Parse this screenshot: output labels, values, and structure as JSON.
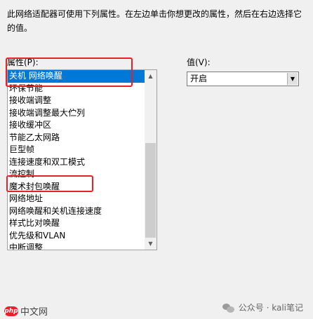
{
  "description": "此网络适配器可使用下列属性。在左边单击你想更改的属性，然后在右边选择它的值。",
  "property_label": "属性(P):",
  "value_label": "值(V):",
  "properties": [
    "关机 网络唤醒",
    "环保节能",
    "接收端调整",
    "接收端调整最大伫列",
    "接收缓冲区",
    "节能乙太网路",
    "巨型帧",
    "连接速度和双工模式",
    "流控制",
    "魔术封包唤醒",
    "网络地址",
    "网络唤醒和关机连接速度",
    "样式比对唤醒",
    "优先级和VLAN",
    "中断调整"
  ],
  "selected_index": 0,
  "value_selected": "开启",
  "watermark_left": "中文网",
  "watermark_logo": "php",
  "watermark_right": "公众号 · kali笔记",
  "colors": {
    "selection": "#0078d7",
    "highlight_box": "#e8202a"
  }
}
